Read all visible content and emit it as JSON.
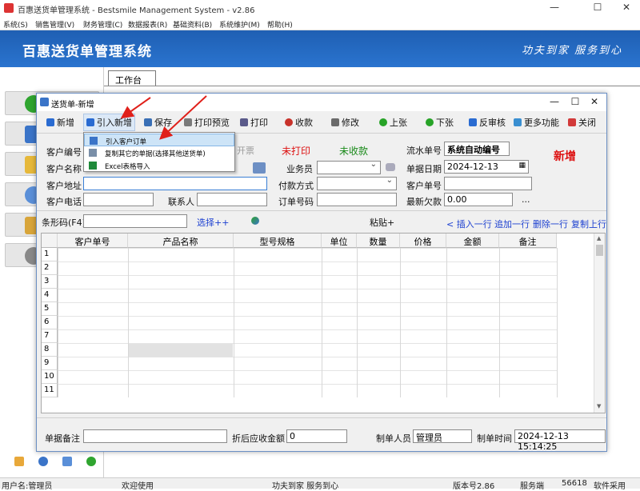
{
  "window": {
    "title": "百惠送货单管理系统 - Bestsmile Management System - v2.86"
  },
  "menu": [
    "系统(S)",
    "销售管理(V)",
    "财务管理(C)",
    "数据报表(R)",
    "基础资料(B)",
    "系统维护(M)",
    "帮助(H)"
  ],
  "banner": {
    "app_name": "百惠送货单管理系统",
    "slogan": "功夫到家 服务到心"
  },
  "workspace_tab": "工作台",
  "dialog": {
    "title": "送货单-新增",
    "toolbar": [
      {
        "label": "新增",
        "icon": "plus-icon",
        "color": "#2a6bd1"
      },
      {
        "label": "引入新增",
        "icon": "plus-icon",
        "color": "#2a6bd1"
      },
      {
        "label": "保存",
        "icon": "save-icon",
        "color": "#3a6fb5"
      },
      {
        "label": "打印预览",
        "icon": "print-preview-icon",
        "color": "#7a7a7a"
      },
      {
        "label": "打印",
        "icon": "printer-icon",
        "color": "#5a5a8a"
      },
      {
        "label": "收款",
        "icon": "money-icon",
        "color": "#c8322a"
      },
      {
        "label": "修改",
        "icon": "edit-icon",
        "color": "#6a6a6a"
      },
      {
        "label": "上张",
        "icon": "prev-icon",
        "color": "#27a327"
      },
      {
        "label": "下张",
        "icon": "next-icon",
        "color": "#27a327"
      },
      {
        "label": "反审核",
        "icon": "unaudit-icon",
        "color": "#2a6bd1"
      },
      {
        "label": "更多功能",
        "icon": "more-icon",
        "color": "#3a8fd1"
      },
      {
        "label": "关闭",
        "icon": "close-icon",
        "color": "#d23a3a"
      }
    ],
    "dropdown": [
      {
        "label": "引入客户订单",
        "icon": "import-order-icon"
      },
      {
        "label": "复制其它的单据(选择其他送货单)",
        "icon": "copy-doc-icon"
      },
      {
        "label": "Excel表格导入",
        "icon": "excel-icon"
      }
    ],
    "form": {
      "customer_code_label": "客户编号",
      "customer_name_label": "客户名称",
      "customer_addr_label": "客户地址",
      "customer_phone_label": "客户电话",
      "contact_label": "联系人",
      "status_open": "开票",
      "status_print": "未打印",
      "status_collect": "未收款",
      "salesman_label": "业务员",
      "payment_label": "付款方式",
      "order_no_label": "订单号码",
      "serial_label": "流水单号",
      "serial_value": "系统自动编号",
      "new_badge": "新增",
      "date_label": "单据日期",
      "date_value": "2024-12-13",
      "cust_no_label": "客户单号",
      "latest_debt_label": "最新欠款",
      "latest_debt_value": "0.00",
      "ellipsis": "..."
    },
    "barcode": {
      "label": "条形码(F4)",
      "select_link": "选择++",
      "paste": "粘贴+",
      "insert_row": "< 插入一行",
      "append_row": "追加一行",
      "delete_row": "删除一行",
      "copy_row": "复制上行"
    },
    "grid": {
      "columns": [
        "客户单号",
        "产品名称",
        "型号规格",
        "单位",
        "数量",
        "价格",
        "金额",
        "备注"
      ],
      "rows": [
        "1",
        "2",
        "3",
        "4",
        "5",
        "6",
        "7",
        "8",
        "9",
        "10",
        "11"
      ]
    },
    "footer": {
      "remark_label": "单据备注",
      "discount_label": "折后应收金额",
      "discount_value": "0",
      "maker_label": "制单人员",
      "maker_value": "管理员",
      "time_label": "制单时间",
      "time_value": "2024-12-13 15:14:25"
    }
  },
  "statusbar": {
    "user": "用户名:管理员",
    "welcome": "欢迎使用",
    "slogan": "功夫到家 服务到心",
    "version": "版本号2.86",
    "server": "服务端",
    "port": "56618",
    "more": "软件采用"
  }
}
